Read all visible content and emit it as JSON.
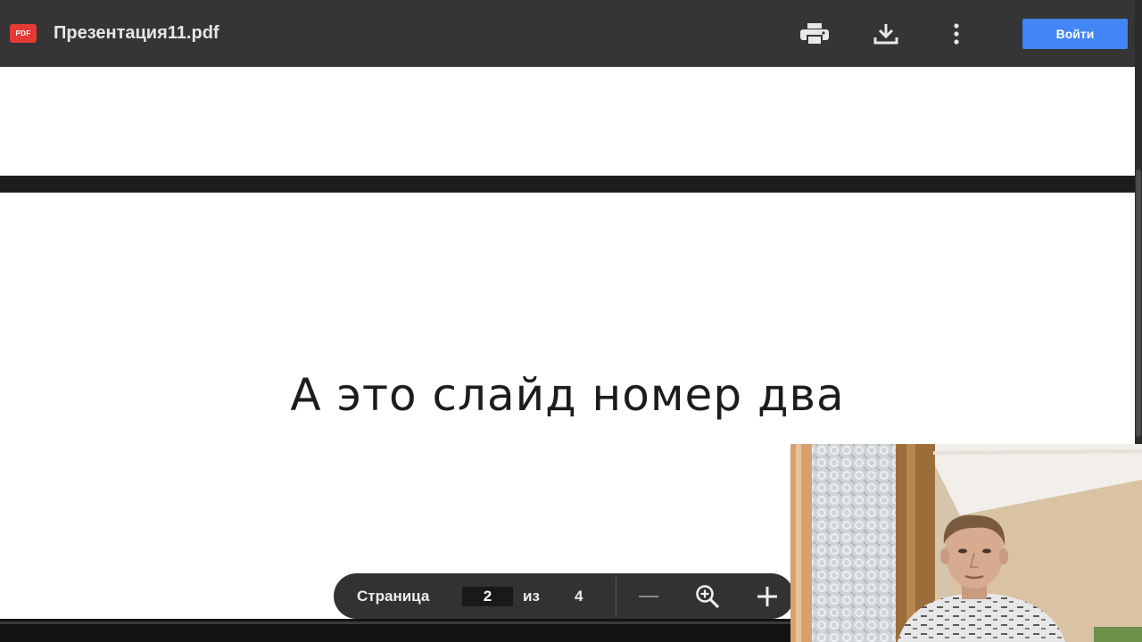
{
  "toolbar": {
    "file_badge": "PDF",
    "file_title": "Презентация11.pdf",
    "print_icon": "print-icon",
    "download_icon": "download-icon",
    "more_icon": "more-vert-icon",
    "login_label": "Войти"
  },
  "slide": {
    "text": "А это слайд номер два"
  },
  "page_nav": {
    "page_label": "Страница",
    "current_page": "2",
    "of_label": "из",
    "total_pages": "4",
    "zoom_out_icon": "minus-icon",
    "fit_icon": "zoom-in-magnifier-icon",
    "zoom_in_icon": "plus-icon"
  },
  "colors": {
    "toolbar_bg": "#353535",
    "accent_button": "#4285f4",
    "pdf_badge": "#e53935",
    "nav_pill_bg": "#323232"
  }
}
